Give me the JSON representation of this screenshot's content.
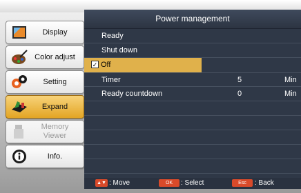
{
  "sidebar": {
    "items": [
      {
        "label": "Display",
        "icon": "display-icon"
      },
      {
        "label": "Color adjust",
        "icon": "palette-icon"
      },
      {
        "label": "Setting",
        "icon": "gears-icon"
      },
      {
        "label": "Expand",
        "icon": "expand-icon",
        "state": "active"
      },
      {
        "label": "Memory Viewer",
        "label_line1": "Memory",
        "label_line2": "Viewer",
        "icon": "usb-icon",
        "state": "disabled"
      },
      {
        "label": "Info.",
        "icon": "info-icon"
      }
    ]
  },
  "panel": {
    "title": "Power management",
    "rows": [
      {
        "label": "Ready"
      },
      {
        "label": "Shut down"
      },
      {
        "label": "Off",
        "checked": true,
        "selected": true
      },
      {
        "label": "Timer",
        "value": "5",
        "unit": "Min"
      },
      {
        "label": "Ready countdown",
        "value": "0",
        "unit": "Min"
      }
    ]
  },
  "footer": {
    "move_label": ": Move",
    "ok_key": "OK",
    "select_label": ": Select",
    "esc_key": "Esc",
    "back_label": ": Back"
  },
  "colors": {
    "panel_bg": "#2f3847",
    "highlight": "#e0b14b",
    "active_item": "#e3a524",
    "key_red": "#d94a2a"
  }
}
